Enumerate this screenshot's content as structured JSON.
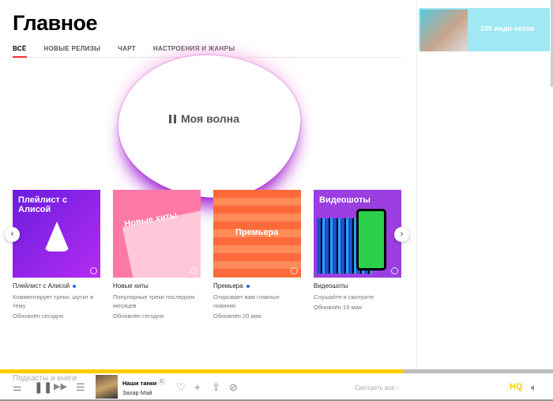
{
  "page": {
    "title": "Главное",
    "tabs": [
      "ВСЁ",
      "НОВЫЕ РЕЛИЗЫ",
      "ЧАРТ",
      "НАСТРОЕНИЯ И ЖАНРЫ"
    ]
  },
  "wave": {
    "label": "Моя волна"
  },
  "cards": [
    {
      "cover_title": "Плейлист с Алисой",
      "title": "Плейлист с Алисой",
      "new": true,
      "desc": "Комментирует треки, шутит в тему",
      "updated": "Обновлён сегодня",
      "color": "#8a2be2"
    },
    {
      "cover_title": "Новые хиты",
      "title": "Новые хиты",
      "new": false,
      "desc": "Популярные треки последних месяцев",
      "updated": "Обновлён сегодня",
      "color": "#ff7aa0"
    },
    {
      "cover_title": "Премьера",
      "title": "Премьера",
      "new": true,
      "desc": "Открывает вам главные новинки",
      "updated": "Обновлён 20 мая",
      "color": "#ff7043"
    },
    {
      "cover_title": "Видеошоты",
      "title": "Видеошоты",
      "new": false,
      "desc": "Слушайте и смотрите",
      "updated": "Обновлён 19 мая",
      "color": "#9b3fe0"
    }
  ],
  "sidebar": {
    "promo": "100 инди-хитов"
  },
  "behind": {
    "section": "Подкасты и книги",
    "see_all": "Смотреть всё ›"
  },
  "player": {
    "track": "Наши танки",
    "badge": "E",
    "artist": "Захар Май",
    "quality": "HQ",
    "progress": 0.73
  }
}
